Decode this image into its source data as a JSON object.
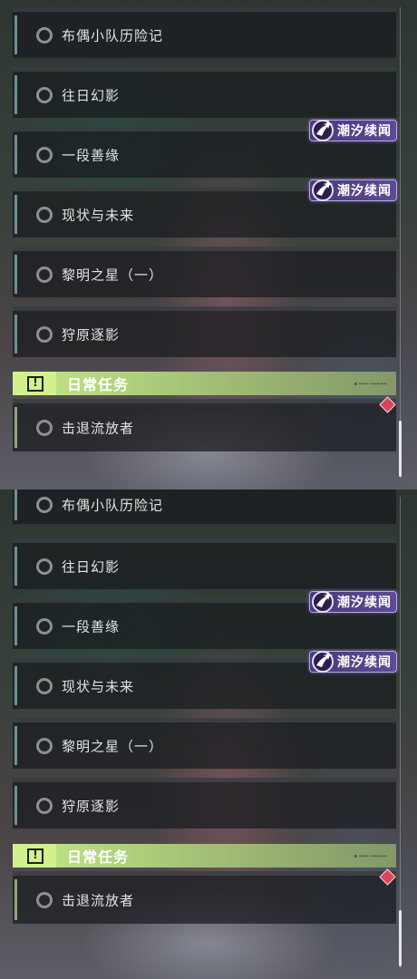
{
  "panels": [
    {
      "quests": [
        {
          "label": "布偶小队历险记"
        },
        {
          "label": "往日幻影"
        },
        {
          "label": "一段善缘"
        },
        {
          "label": "现状与未来"
        },
        {
          "label": "黎明之星（一）"
        },
        {
          "label": "狩原逐影"
        }
      ],
      "badges": [
        {
          "text": "潮汐续闻",
          "icon": "tide-emblem-icon"
        },
        {
          "text": "潮汐续闻",
          "icon": "tide-emblem-icon"
        }
      ],
      "daily_section": {
        "title": "日常任务",
        "icon": "exclamation-box-icon",
        "quests": [
          {
            "label": "击退流放者"
          }
        ]
      }
    },
    {
      "quests": [
        {
          "label": "布偶小队历险记"
        },
        {
          "label": "往日幻影"
        },
        {
          "label": "一段善缘"
        },
        {
          "label": "现状与未来"
        },
        {
          "label": "黎明之星（一）"
        },
        {
          "label": "狩原逐影"
        }
      ],
      "badges": [
        {
          "text": "潮汐续闻",
          "icon": "tide-emblem-icon"
        },
        {
          "text": "潮汐续闻",
          "icon": "tide-emblem-icon"
        }
      ],
      "daily_section": {
        "title": "日常任务",
        "icon": "exclamation-box-icon",
        "quests": [
          {
            "label": "击退流放者"
          }
        ]
      }
    }
  ],
  "colors": {
    "daily_accent": "#c5e88a",
    "badge_purple": "#5e4a96",
    "alert_red": "#d9455b",
    "quest_bar": "#6f8f99"
  }
}
